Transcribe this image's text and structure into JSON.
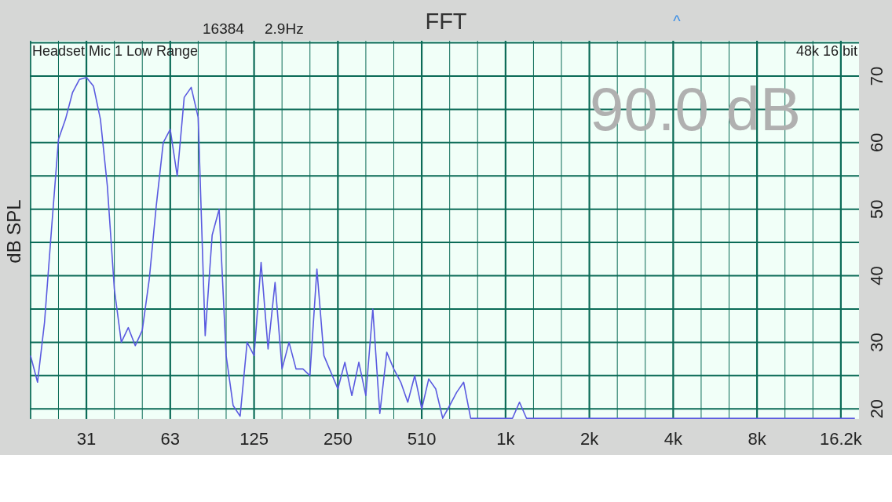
{
  "header": {
    "fft_size": "16384",
    "resolution": "2.9Hz",
    "caret": "^"
  },
  "plot": {
    "input_label": "Headset Mic 1 Low Range",
    "format_label": "48k 16 bit",
    "level_reading": "90.0 dB",
    "chart_data": {
      "type": "line",
      "grid": true,
      "title": "FFT",
      "ylabel": "dB SPL",
      "ylim": [
        18.5,
        75.3
      ],
      "yticks": [
        20,
        30,
        40,
        50,
        60,
        70
      ],
      "categories": [
        null,
        null,
        null,
        null,
        null,
        null,
        null,
        null,
        "31",
        null,
        null,
        null,
        null,
        null,
        null,
        null,
        null,
        null,
        null,
        null,
        "63",
        null,
        null,
        null,
        null,
        null,
        null,
        null,
        null,
        null,
        null,
        null,
        "125",
        null,
        null,
        null,
        null,
        null,
        null,
        null,
        null,
        null,
        null,
        null,
        "250",
        null,
        null,
        null,
        null,
        null,
        null,
        null,
        null,
        null,
        null,
        null,
        "510",
        null,
        null,
        null,
        null,
        null,
        null,
        null,
        null,
        null,
        null,
        null,
        "1k",
        null,
        null,
        null,
        null,
        null,
        null,
        null,
        null,
        null,
        null,
        null,
        "2k",
        null,
        null,
        null,
        null,
        null,
        null,
        null,
        null,
        null,
        null,
        null,
        "4k",
        null,
        null,
        null,
        null,
        null,
        null,
        null,
        null,
        null,
        null,
        null,
        "8k",
        null,
        null,
        null,
        null,
        null,
        null,
        null,
        null,
        null,
        null,
        null,
        "16.2k",
        null,
        null
      ],
      "series": [
        {
          "color": "#5a5ae0",
          "values": [
            28,
            24,
            33,
            47,
            60.5,
            63.5,
            67.5,
            69.5,
            69.8,
            68.5,
            63.5,
            53.5,
            38,
            30,
            32.2,
            29.5,
            31.8,
            39.5,
            50.5,
            60,
            62,
            55,
            66.8,
            68.3,
            63.8,
            31,
            46.1,
            50,
            28,
            20.5,
            18.9,
            30,
            28,
            42,
            29,
            39,
            26,
            30,
            26,
            26,
            25,
            41,
            28,
            25.5,
            23,
            27,
            22,
            27,
            22,
            35,
            19.3,
            28.5,
            26,
            24,
            21,
            25,
            20,
            24.5,
            23,
            18.6,
            20.5,
            22.5,
            24,
            18.6,
            18.6,
            18.6,
            18.6,
            18.6,
            18.6,
            18.6,
            21,
            18.6,
            18.6,
            18.6,
            18.6,
            18.6,
            18.6,
            18.6,
            18.6,
            18.6,
            18.6,
            18.6,
            18.6,
            18.6,
            18.6,
            18.6,
            18.6,
            18.6,
            18.6,
            18.6,
            18.6,
            18.6,
            18.6,
            18.6,
            18.6,
            18.6,
            18.6,
            18.6,
            18.6,
            18.6,
            18.6,
            18.6,
            18.6,
            18.6,
            18.6,
            18.6,
            18.6,
            18.6,
            18.6,
            18.6,
            18.6,
            18.6,
            18.6,
            18.6,
            18.6,
            18.6,
            18.6,
            18.6,
            18.6
          ]
        }
      ]
    }
  }
}
